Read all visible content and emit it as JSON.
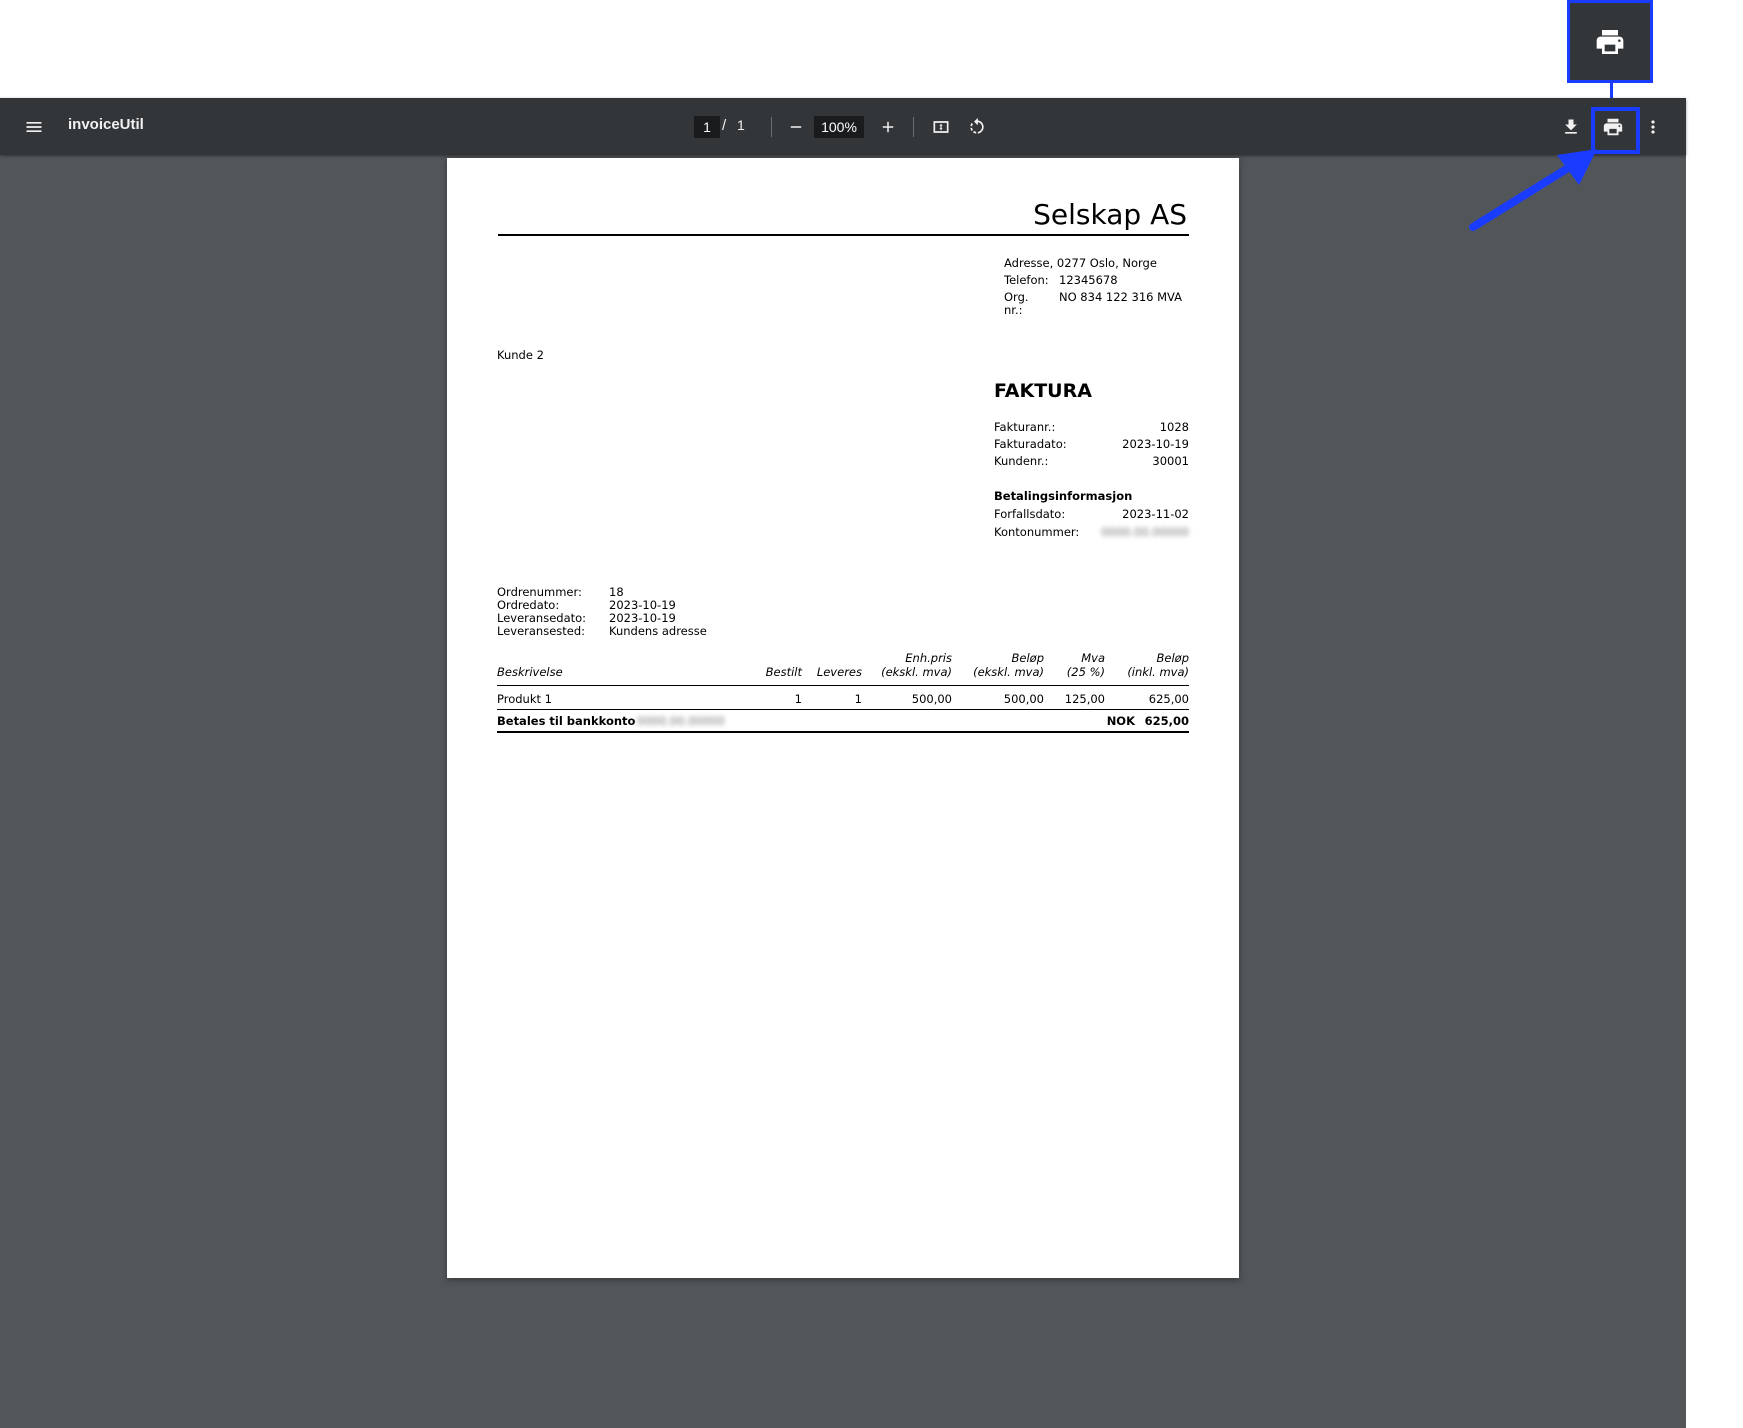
{
  "toolbar": {
    "title": "invoiceUtil",
    "page_current": "1",
    "page_separator": "/",
    "page_total": "1",
    "zoom": "100%"
  },
  "invoice": {
    "company": "Selskap AS",
    "address_label": "Adresse, 0277 Oslo, Norge",
    "phone_label": "Telefon:",
    "phone_value": "12345678",
    "org_label_1": "Org.",
    "org_label_2": "nr.:",
    "org_value": "NO 834 122 316 MVA",
    "customer": "Kunde 2",
    "heading": "FAKTURA",
    "fakturanr_label": "Fakturanr.:",
    "fakturanr_value": "1028",
    "fakturadato_label": "Fakturadato:",
    "fakturadato_value": "2023-10-19",
    "kundenr_label": "Kundenr.:",
    "kundenr_value": "30001",
    "payment_heading": "Betalingsinformasjon",
    "forfall_label": "Forfallsdato:",
    "forfall_value": "2023-11-02",
    "konto_label": "Kontonummer:",
    "konto_value": "0000.00.00000",
    "ordrenr_label": "Ordrenummer:",
    "ordrenr_value": "18",
    "ordredato_label": "Ordredato:",
    "ordredato_value": "2023-10-19",
    "levdato_label": "Leveransedato:",
    "levdato_value": "2023-10-19",
    "levsted_label": "Leveransested:",
    "levsted_value": "Kundens adresse",
    "columns": {
      "beskrivelse": "Beskrivelse",
      "bestilt": "Bestilt",
      "leveres": "Leveres",
      "enhpris_1": "Enh.pris",
      "enhpris_2": "(ekskl. mva)",
      "belop_1": "Beløp",
      "belop_2": "(ekskl. mva)",
      "mva_1": "Mva",
      "mva_2": "(25 %)",
      "belop_inkl_1": "Beløp",
      "belop_inkl_2": "(inkl. mva)"
    },
    "row": {
      "beskrivelse": "Produkt 1",
      "bestilt": "1",
      "leveres": "1",
      "enhpris": "500,00",
      "belop": "500,00",
      "mva": "125,00",
      "belop_inkl": "625,00"
    },
    "total_label": "Betales til bankkonto",
    "total_account": "0000.00.00000",
    "total_currency": "NOK",
    "total_value": "625,00"
  },
  "colors": {
    "highlight": "#1a3cff",
    "toolbar_bg": "#323639",
    "viewer_bg": "#525659"
  },
  "icons": [
    "menu-icon",
    "minus-icon",
    "plus-icon",
    "fit-page-icon",
    "rotate-icon",
    "download-icon",
    "print-icon",
    "more-vertical-icon",
    "arrow-pointer-icon"
  ]
}
